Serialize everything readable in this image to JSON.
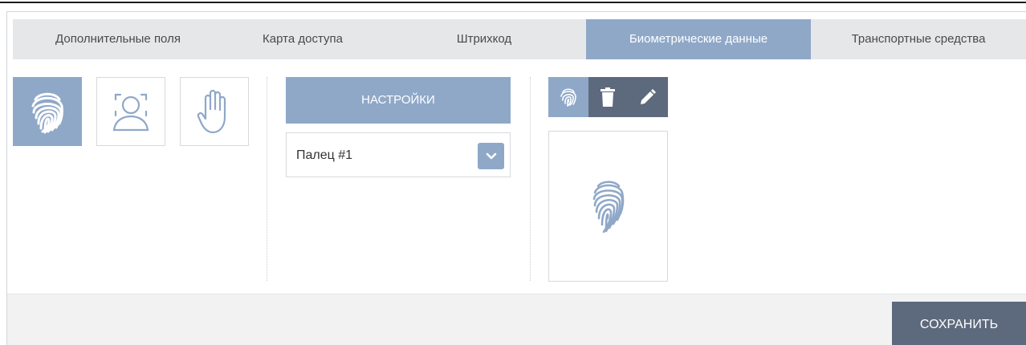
{
  "tabs": [
    {
      "label": "Дополнительные поля",
      "active": false
    },
    {
      "label": "Карта доступа",
      "active": false
    },
    {
      "label": "Штрихкод",
      "active": false
    },
    {
      "label": "Биометрические данные",
      "active": true
    },
    {
      "label": "Транспортные средства",
      "active": false
    }
  ],
  "biometric_types": [
    {
      "icon": "fingerprint-icon",
      "active": true
    },
    {
      "icon": "face-icon",
      "active": false
    },
    {
      "icon": "palm-icon",
      "active": false
    }
  ],
  "settings": {
    "button_label": "НАСТРОЙКИ",
    "finger_select_value": "Палец #1"
  },
  "template_toolbar": {
    "icons": [
      "fingerprint-icon",
      "trash-icon",
      "pencil-icon"
    ]
  },
  "footer": {
    "save_label": "СОХРАНИТЬ"
  },
  "colors": {
    "accent": "#8fa8c8",
    "dark": "#5d6a7d",
    "tab_bar": "#e6e7e9"
  }
}
